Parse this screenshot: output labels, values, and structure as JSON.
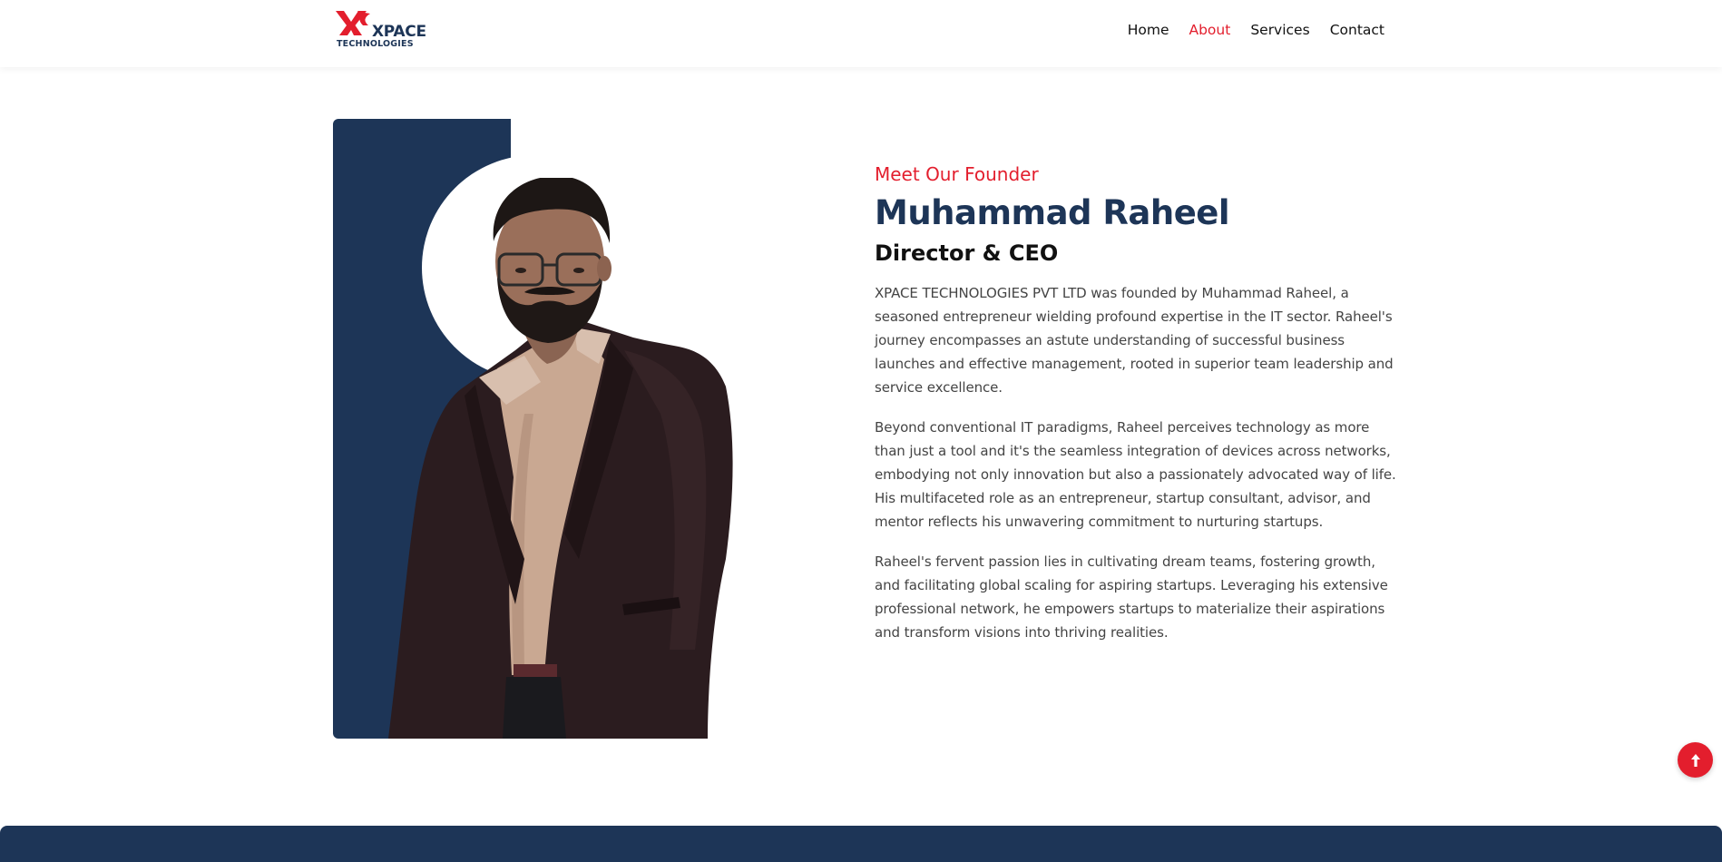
{
  "brand": {
    "name": "XPACE",
    "subtitle": "TECHNOLOGIES",
    "primary_color": "#1d3557",
    "accent_color": "#e31e2d"
  },
  "nav": {
    "items": [
      {
        "label": "Home",
        "active": false
      },
      {
        "label": "About",
        "active": true
      },
      {
        "label": "Services",
        "active": false
      },
      {
        "label": "Contact",
        "active": false
      }
    ]
  },
  "founder": {
    "eyebrow": "Meet Our Founder",
    "name": "Muhammad Raheel",
    "role": "Director & CEO",
    "paragraphs": [
      "XPACE TECHNOLOGIES PVT LTD was founded by Muhammad Raheel, a seasoned entrepreneur wielding profound expertise in the IT sector. Raheel's journey encompasses an astute understanding of successful business launches and effective management, rooted in superior team leadership and service excellence.",
      "Beyond conventional IT paradigms, Raheel perceives technology as more than just a tool and it's the seamless integration of devices across networks, embodying not only innovation but also a passionately advocated way of life. His multifaceted role as an entrepreneur, startup consultant, advisor, and mentor reflects his unwavering commitment to nurturing startups.",
      "Raheel's fervent passion lies in cultivating dream teams, fostering growth, and facilitating global scaling for aspiring startups. Leveraging his extensive professional network, he empowers startups to materialize their aspirations and transform visions into thriving realities."
    ]
  },
  "icons": {
    "scroll_top": "arrow-up-icon"
  }
}
